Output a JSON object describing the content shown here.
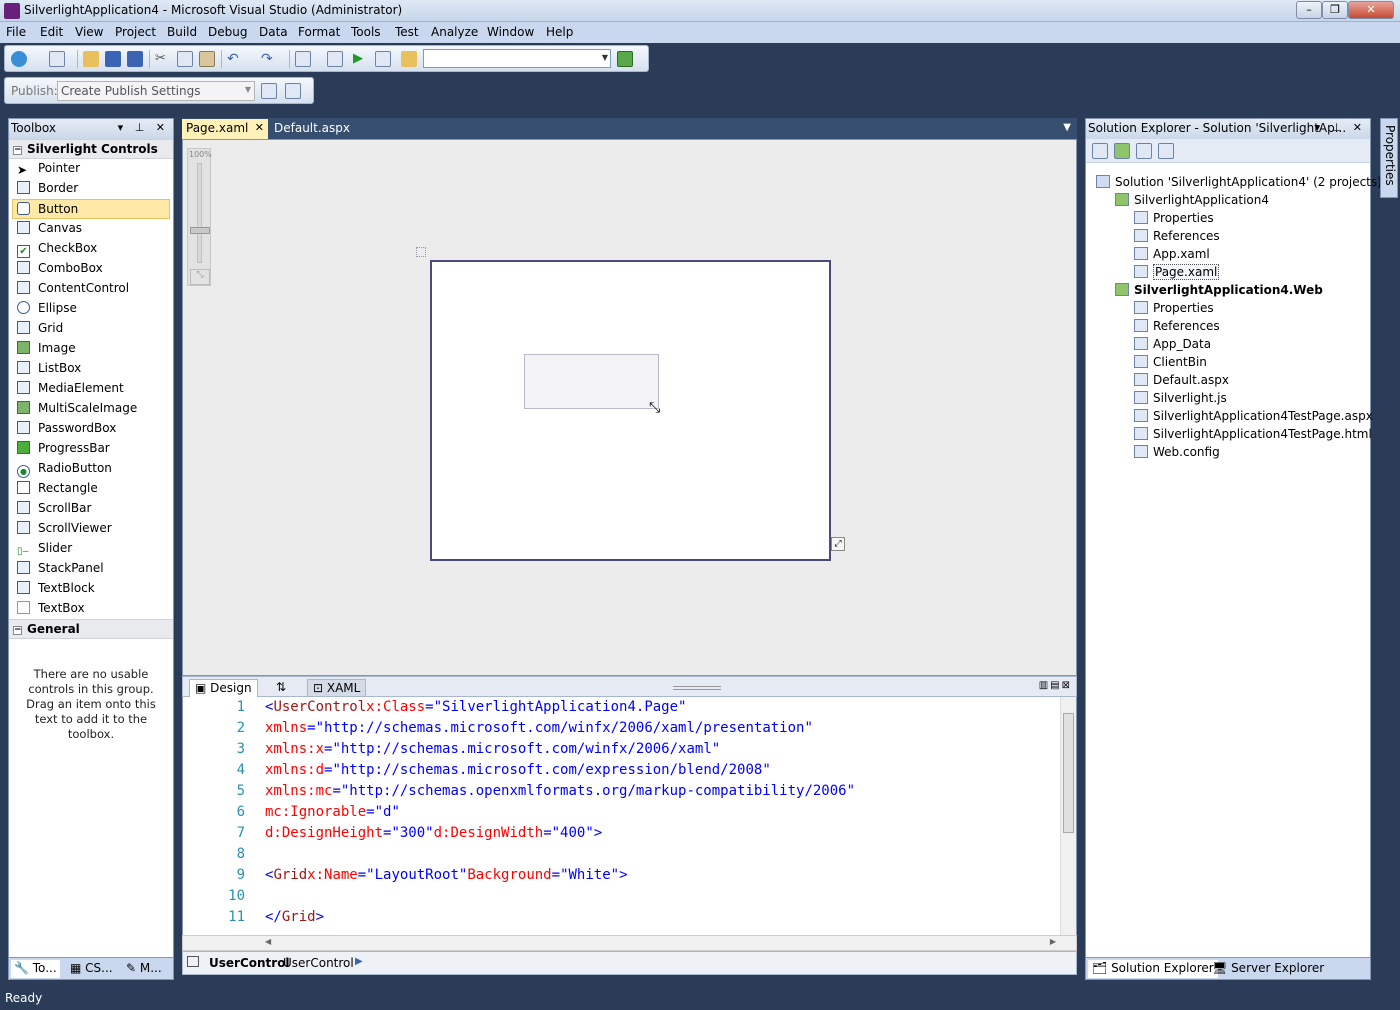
{
  "window": {
    "title": "SilverlightApplication4 - Microsoft Visual Studio (Administrator)"
  },
  "menu": [
    "File",
    "Edit",
    "View",
    "Project",
    "Build",
    "Debug",
    "Data",
    "Format",
    "Tools",
    "Test",
    "Analyze",
    "Window",
    "Help"
  ],
  "toolbar2": {
    "publish_label": "Publish:",
    "publish_value": "Create Publish Settings"
  },
  "toolbox": {
    "title": "Toolbox",
    "groups": [
      {
        "name": "Silverlight Controls",
        "items": [
          "Pointer",
          "Border",
          "Button",
          "Canvas",
          "CheckBox",
          "ComboBox",
          "ContentControl",
          "Ellipse",
          "Grid",
          "Image",
          "ListBox",
          "MediaElement",
          "MultiScaleImage",
          "PasswordBox",
          "ProgressBar",
          "RadioButton",
          "Rectangle",
          "ScrollBar",
          "ScrollViewer",
          "Slider",
          "StackPanel",
          "TextBlock",
          "TextBox"
        ]
      },
      {
        "name": "General",
        "items": []
      }
    ],
    "selected_item": "Button",
    "empty_message": "There are no usable controls in this group. Drag an item onto this text to add it to the toolbox.",
    "tabs": [
      "To...",
      "CS...",
      "M..."
    ]
  },
  "documents": {
    "tabs": [
      "Page.xaml",
      "Default.aspx"
    ],
    "active": "Page.xaml"
  },
  "designer": {
    "zoom": "100%"
  },
  "split": {
    "design_label": "Design",
    "swap_label": "⇅",
    "xaml_label": "XAML"
  },
  "code": [
    {
      "n": "1",
      "parts": [
        [
          "pun",
          "<"
        ],
        [
          "tag",
          "UserControl"
        ],
        [
          "txt",
          " "
        ],
        [
          "attr",
          "x:Class"
        ],
        [
          "pun",
          "="
        ],
        [
          "val",
          "\"SilverlightApplication4.Page\""
        ]
      ]
    },
    {
      "n": "2",
      "parts": [
        [
          "txt",
          "    "
        ],
        [
          "attr",
          "xmlns"
        ],
        [
          "pun",
          "="
        ],
        [
          "val",
          "\"http://schemas.microsoft.com/winfx/2006/xaml/presentation\""
        ]
      ]
    },
    {
      "n": "3",
      "parts": [
        [
          "txt",
          "    "
        ],
        [
          "attr",
          "xmlns:x"
        ],
        [
          "pun",
          "="
        ],
        [
          "val",
          "\"http://schemas.microsoft.com/winfx/2006/xaml\""
        ]
      ]
    },
    {
      "n": "4",
      "parts": [
        [
          "txt",
          "    "
        ],
        [
          "attr",
          "xmlns:d"
        ],
        [
          "pun",
          "="
        ],
        [
          "val",
          "\"http://schemas.microsoft.com/expression/blend/2008\""
        ]
      ]
    },
    {
      "n": "5",
      "parts": [
        [
          "txt",
          "    "
        ],
        [
          "attr",
          "xmlns:mc"
        ],
        [
          "pun",
          "="
        ],
        [
          "val",
          "\"http://schemas.openxmlformats.org/markup-compatibility/2006\""
        ]
      ]
    },
    {
      "n": "6",
      "parts": [
        [
          "txt",
          "    "
        ],
        [
          "attr",
          "mc:Ignorable"
        ],
        [
          "pun",
          "="
        ],
        [
          "val",
          "\"d\""
        ]
      ]
    },
    {
      "n": "7",
      "parts": [
        [
          "txt",
          "    "
        ],
        [
          "attr",
          "d:DesignHeight"
        ],
        [
          "pun",
          "="
        ],
        [
          "val",
          "\"300\""
        ],
        [
          "txt",
          " "
        ],
        [
          "attr",
          "d:DesignWidth"
        ],
        [
          "pun",
          "="
        ],
        [
          "val",
          "\"400\""
        ],
        [
          "pun",
          ">"
        ]
      ]
    },
    {
      "n": "8",
      "parts": []
    },
    {
      "n": "9",
      "parts": [
        [
          "txt",
          "    "
        ],
        [
          "pun",
          "<"
        ],
        [
          "tag",
          "Grid"
        ],
        [
          "txt",
          " "
        ],
        [
          "attr",
          "x:Name"
        ],
        [
          "pun",
          "="
        ],
        [
          "val",
          "\"LayoutRoot\""
        ],
        [
          "txt",
          " "
        ],
        [
          "attr",
          "Background"
        ],
        [
          "pun",
          "="
        ],
        [
          "val",
          "\"White\""
        ],
        [
          "pun",
          ">"
        ]
      ]
    },
    {
      "n": "10",
      "parts": []
    },
    {
      "n": "11",
      "parts": [
        [
          "txt",
          "    "
        ],
        [
          "pun",
          "</"
        ],
        [
          "tag",
          "Grid"
        ],
        [
          "pun",
          ">"
        ]
      ]
    }
  ],
  "breadcrumb": {
    "element": "UserControl",
    "detail": "UserControl"
  },
  "solution_explorer": {
    "title": "Solution Explorer - Solution 'SilverlightAp...",
    "items": [
      {
        "label": "Solution 'SilverlightApplication4' (2 projects)",
        "level": 0,
        "bold": false
      },
      {
        "label": "SilverlightApplication4",
        "level": 1,
        "bold": false
      },
      {
        "label": "Properties",
        "level": 2,
        "bold": false
      },
      {
        "label": "References",
        "level": 2,
        "bold": false
      },
      {
        "label": "App.xaml",
        "level": 2,
        "bold": false
      },
      {
        "label": "Page.xaml",
        "level": 2,
        "bold": false,
        "selected": true
      },
      {
        "label": "SilverlightApplication4.Web",
        "level": 1,
        "bold": true
      },
      {
        "label": "Properties",
        "level": 2,
        "bold": false
      },
      {
        "label": "References",
        "level": 2,
        "bold": false
      },
      {
        "label": "App_Data",
        "level": 2,
        "bold": false
      },
      {
        "label": "ClientBin",
        "level": 2,
        "bold": false
      },
      {
        "label": "Default.aspx",
        "level": 2,
        "bold": false
      },
      {
        "label": "Silverlight.js",
        "level": 2,
        "bold": false
      },
      {
        "label": "SilverlightApplication4TestPage.aspx",
        "level": 2,
        "bold": false
      },
      {
        "label": "SilverlightApplication4TestPage.html",
        "level": 2,
        "bold": false
      },
      {
        "label": "Web.config",
        "level": 2,
        "bold": false
      }
    ],
    "tabs": [
      "Solution Explorer",
      "Server Explorer"
    ]
  },
  "properties_tab": "Properties",
  "status": "Ready"
}
